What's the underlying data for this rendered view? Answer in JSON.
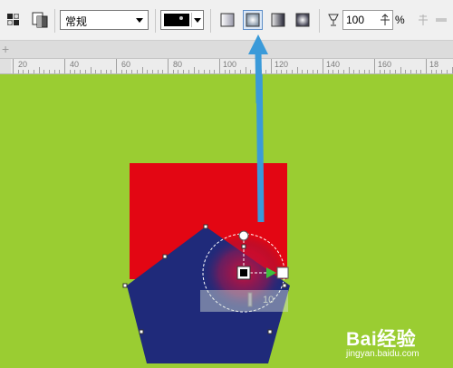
{
  "toolbar": {
    "style_preset": "常规",
    "opacity_value": "100",
    "opacity_unit": "%",
    "icons": [
      "grid-pattern-icon",
      "gradient-copy-icon",
      "fill-color-swatch",
      "rect-gradient-icon",
      "rect-gradient-selected-icon",
      "corner-gradient-icon",
      "square-gradient-icon",
      "transparency-goblet-icon",
      "link-lock-icon",
      "dimension-icon"
    ]
  },
  "tabstrip": {
    "plus": "+"
  },
  "ruler": {
    "labels": [
      "20",
      "40",
      "60",
      "80",
      "100",
      "120",
      "140",
      "160",
      "18"
    ]
  },
  "canvas": {
    "background": "#9acd32",
    "red_square": "#e30613",
    "pentagon": "#1f2a7a",
    "slider_value": "10"
  },
  "watermark": {
    "brand": "Bai经验",
    "url": "jingyan.baidu.com"
  },
  "colors": {
    "arrow": "#3a9ad9",
    "accent_pressed": "#5e8fc8"
  }
}
